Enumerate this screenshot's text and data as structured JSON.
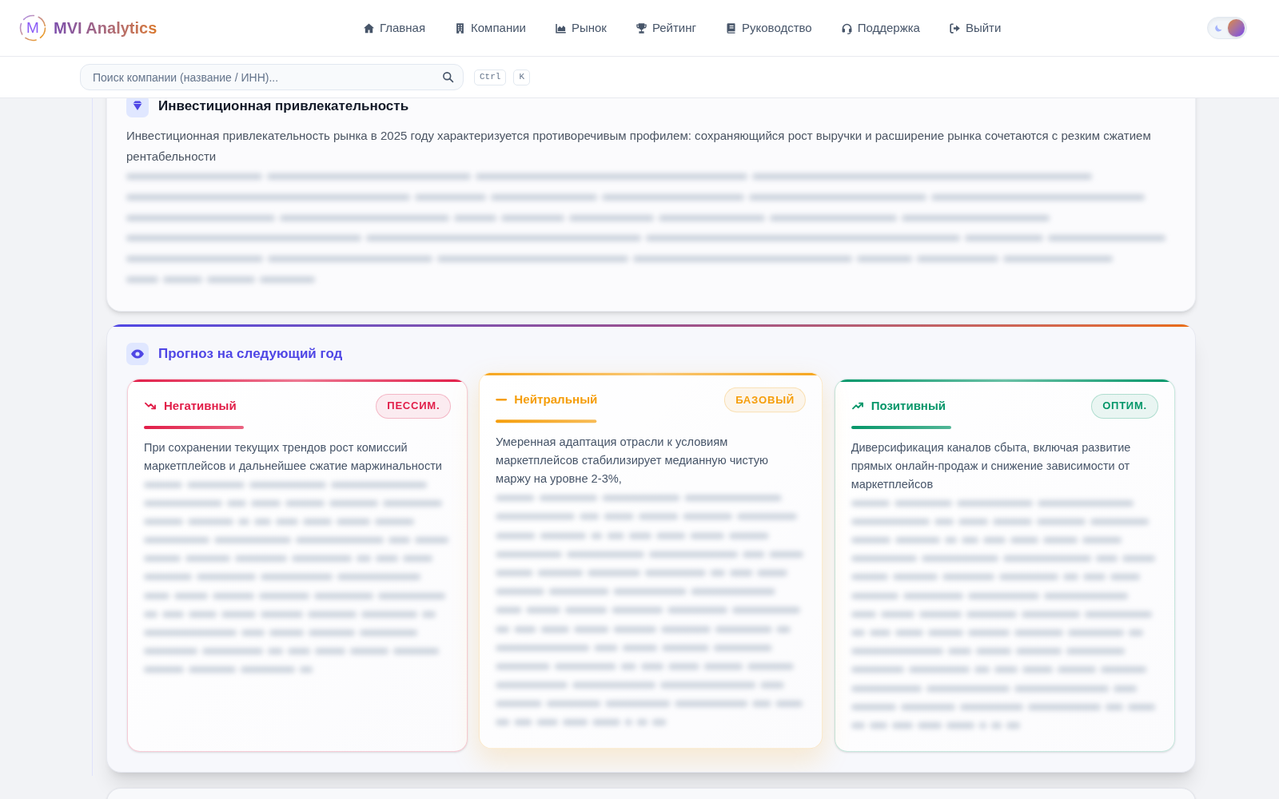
{
  "header": {
    "logo": {
      "mark": "M",
      "text": "MVI Analytics"
    },
    "nav": [
      {
        "kind": "home",
        "label": "Главная"
      },
      {
        "kind": "building",
        "label": "Компании"
      },
      {
        "kind": "chart",
        "label": "Рынок"
      },
      {
        "kind": "trophy",
        "label": "Рейтинг"
      },
      {
        "kind": "book",
        "label": "Руководство"
      },
      {
        "kind": "headset",
        "label": "Поддержка"
      },
      {
        "kind": "logout",
        "label": "Выйти"
      }
    ],
    "theme_toggle": {
      "light": true
    }
  },
  "search": {
    "placeholder": "Поиск компании (название / ИНН)...",
    "shortcut": [
      "Ctrl",
      "K"
    ]
  },
  "attractiveness": {
    "title": "Инвестиционная привлекательность",
    "text": "Инвестиционная привлекательность рынка в 2025 году характеризуется противоречивым профилем: сохраняющийся рост выручки и расширение рынка сочетаются с резким сжатием рентабельности"
  },
  "forecast": {
    "title": "Прогноз на следующий год",
    "scenarios": [
      {
        "kind": "negative",
        "title": "Негативный",
        "badge": "ПЕССИМ.",
        "color": "#e11d48",
        "hovered": false,
        "text": "При сохранении текущих трендов рост комиссий маркетплейсов и дальнейшее сжатие маржинальности"
      },
      {
        "kind": "neutral",
        "title": "Нейтральный",
        "badge": "БАЗОВЫЙ",
        "color": "#f59e0b",
        "hovered": true,
        "text": "Умеренная адаптация отрасли к условиям маркетплейсов стабилизирует медианную чистую маржу на уровне 2-3%,"
      },
      {
        "kind": "positive",
        "title": "Позитивный",
        "badge": "ОПТИМ.",
        "color": "#059669",
        "hovered": false,
        "text": "Диверсификация каналов сбыта, включая развитие прямых онлайн-продаж и снижение зависимости от маркетплейсов"
      }
    ]
  }
}
